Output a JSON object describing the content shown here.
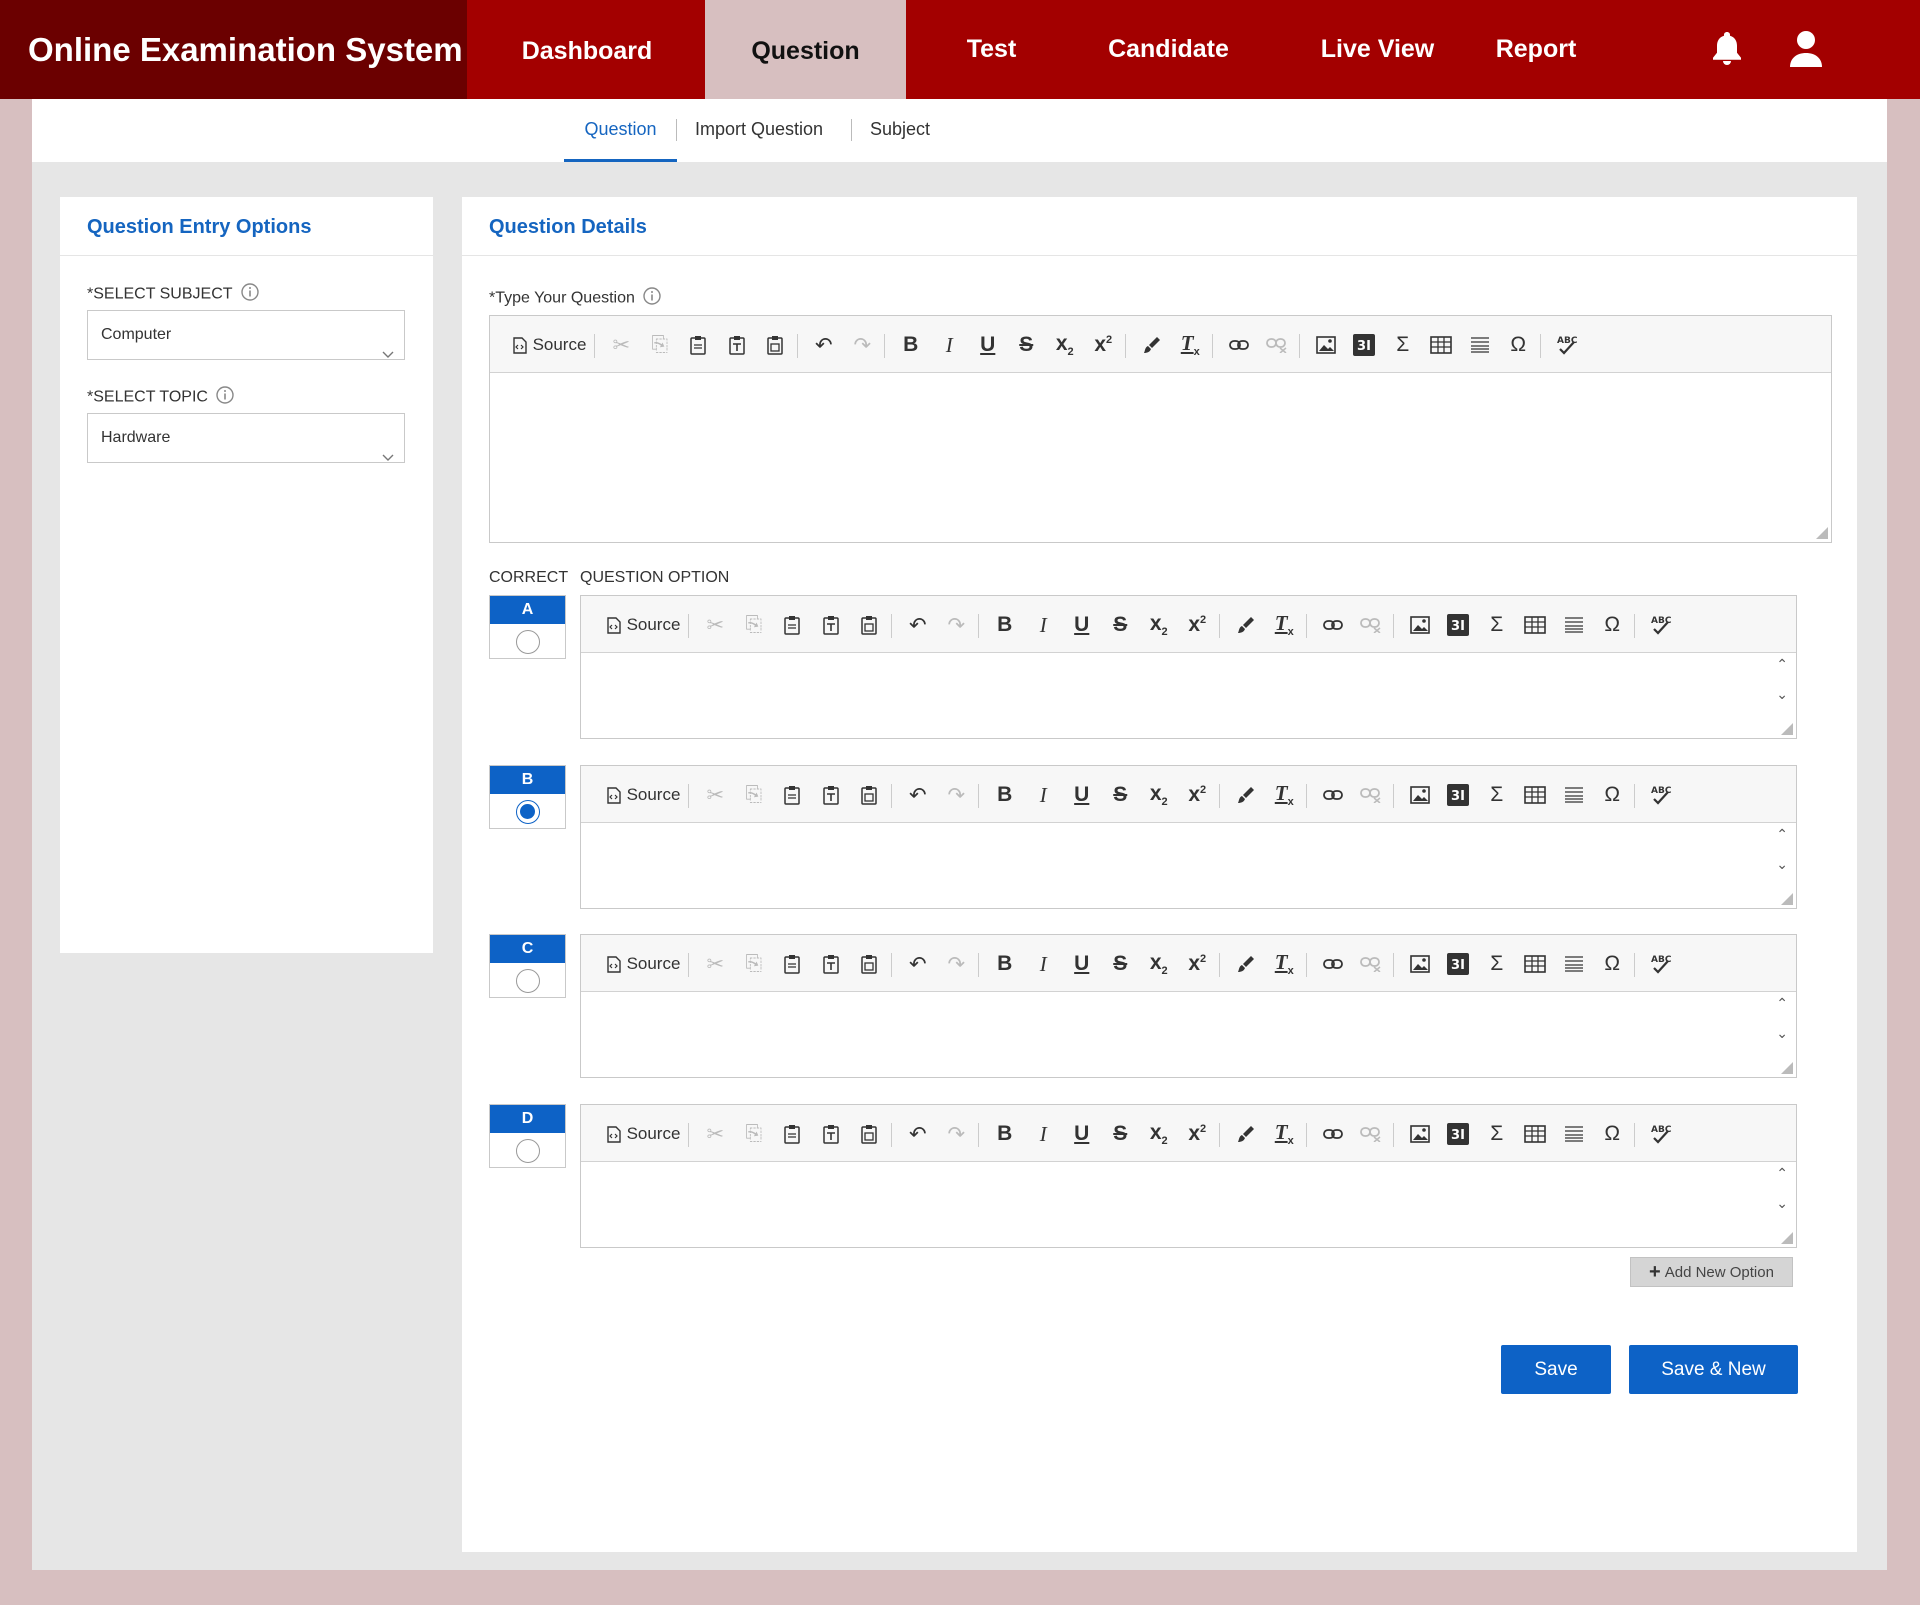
{
  "app": {
    "title": "Online Examination System"
  },
  "nav": {
    "items": [
      {
        "label": "Dashboard"
      },
      {
        "label": "Question"
      },
      {
        "label": "Test"
      },
      {
        "label": "Candidate"
      },
      {
        "label": "Live View"
      },
      {
        "label": "Report"
      }
    ],
    "active": "Question",
    "icons": [
      "bell-icon",
      "user-icon"
    ]
  },
  "subtabs": {
    "items": [
      {
        "label": "Question"
      },
      {
        "label": "Import Question"
      },
      {
        "label": "Subject"
      }
    ],
    "active": "Question"
  },
  "left_panel": {
    "title": "Question Entry Options",
    "subject_label": "*SELECT SUBJECT",
    "subject_value": "Computer",
    "topic_label": "*SELECT TOPIC",
    "topic_value": "Hardware"
  },
  "right_panel": {
    "title": "Question Details",
    "question_label": "*Type Your Question",
    "correct_label": "CORRECT",
    "option_label": "QUESTION OPTION",
    "source_label": "Source",
    "options": [
      {
        "letter": "A",
        "correct": false
      },
      {
        "letter": "B",
        "correct": true
      },
      {
        "letter": "C",
        "correct": false
      },
      {
        "letter": "D",
        "correct": false
      }
    ],
    "add_option_label": "Add New Option",
    "save_label": "Save",
    "save_new_label": "Save & New"
  },
  "colors": {
    "topbar": "#a30000",
    "brand_bg": "#6b0000",
    "accent": "#1565c0",
    "button": "#0d62c6",
    "page_bg": "#d7bfc0"
  }
}
